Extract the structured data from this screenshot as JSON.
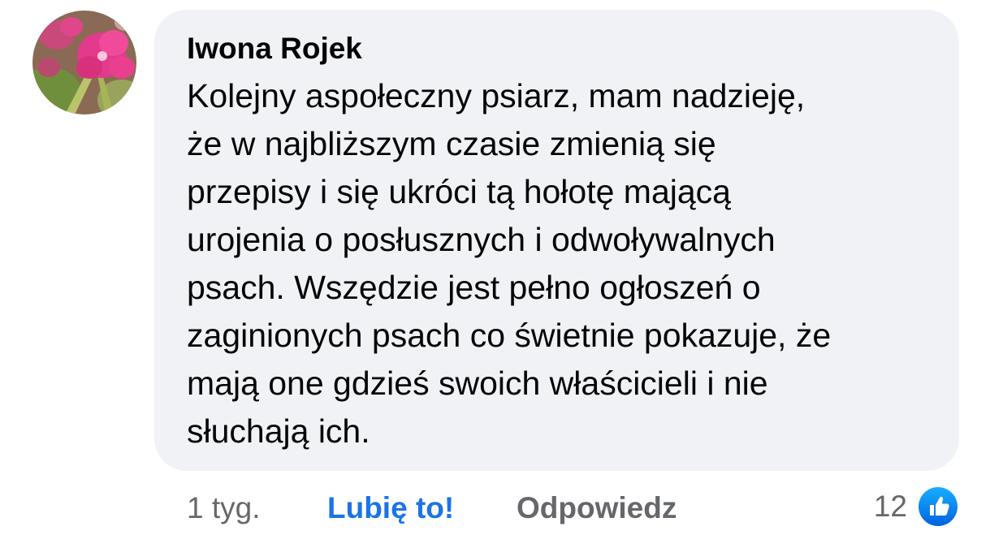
{
  "comment": {
    "author": "Iwona Rojek",
    "text": "Kolejny aspołeczny psiarz, mam nadzieję,\nże w najbliższym czasie zmienią się\nprzepisy i się ukróci tą hołotę mającą\nurojenia o posłusznych i odwoływalnych\npsach. Wszędzie jest pełno ogłoszeń o\nzaginionych psach co świetnie pokazuje, że\nmają one gdzieś swoich właścicieli i nie\nsłuchają ich.",
    "avatar": "flower-avatar"
  },
  "actions": {
    "time": "1 tyg.",
    "like_label": "Lubię to!",
    "reply_label": "Odpowiedz"
  },
  "reactions": {
    "count": "12",
    "icon": "like-thumb-icon"
  },
  "colors": {
    "bubble_bg": "#f0f2f5",
    "like_blue": "#1b74e4",
    "secondary_text": "#65676b",
    "primary_text": "#050505"
  }
}
